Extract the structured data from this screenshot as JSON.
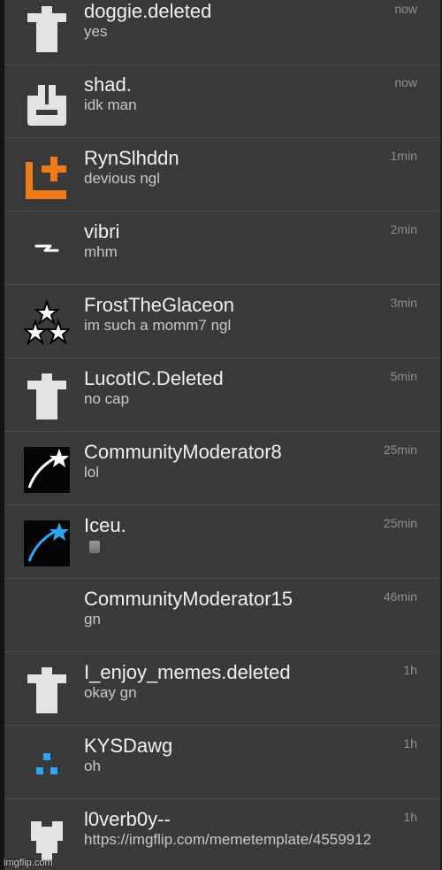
{
  "colors": {
    "background": "#3a3a3a",
    "name": "#f0f0f0",
    "message": "#c8c8c8",
    "time": "#8f8f8f",
    "orange_icon": "#f07a18",
    "blue_icon": "#2aa7f0"
  },
  "rows": [
    {
      "name": "doggie.deleted",
      "message": "yes",
      "time": "now",
      "avatar_icon": "deleted-user-icon"
    },
    {
      "name": "shad.",
      "message": "idk man",
      "time": "now",
      "avatar_icon": "bag-icon"
    },
    {
      "name": "RynSlhddn",
      "message": "devious ngl",
      "time": "1min",
      "avatar_icon": "orange-plus-box-icon"
    },
    {
      "name": "vibri",
      "message": "mhm",
      "time": "2min",
      "avatar_icon": "lightning-squiggle-icon"
    },
    {
      "name": "FrostTheGlaceon",
      "message": "im such a momm7 ngl",
      "time": "3min",
      "avatar_icon": "three-stars-icon"
    },
    {
      "name": "LucotIC.Deleted",
      "message": "no cap",
      "time": "5min",
      "avatar_icon": "deleted-user-icon"
    },
    {
      "name": "CommunityModerator8",
      "message": "lol",
      "time": "25min",
      "avatar_icon": "shooting-star-white-icon"
    },
    {
      "name": "Iceu.",
      "message": "",
      "time": "25min",
      "avatar_icon": "shooting-star-blue-icon"
    },
    {
      "name": "CommunityModerator15",
      "message": "gn",
      "time": "46min",
      "avatar_icon": "none"
    },
    {
      "name": "I_enjoy_memes.deleted",
      "message": "okay gn",
      "time": "1h",
      "avatar_icon": "deleted-user-icon"
    },
    {
      "name": "KYSDawg",
      "message": "oh",
      "time": "1h",
      "avatar_icon": "blue-dots-icon"
    },
    {
      "name": "l0verb0y--",
      "message": "https://imgflip.com/memetemplate/4559912",
      "time": "1h",
      "avatar_icon": "heart-shape-icon"
    }
  ],
  "watermark": "imgflip.com"
}
